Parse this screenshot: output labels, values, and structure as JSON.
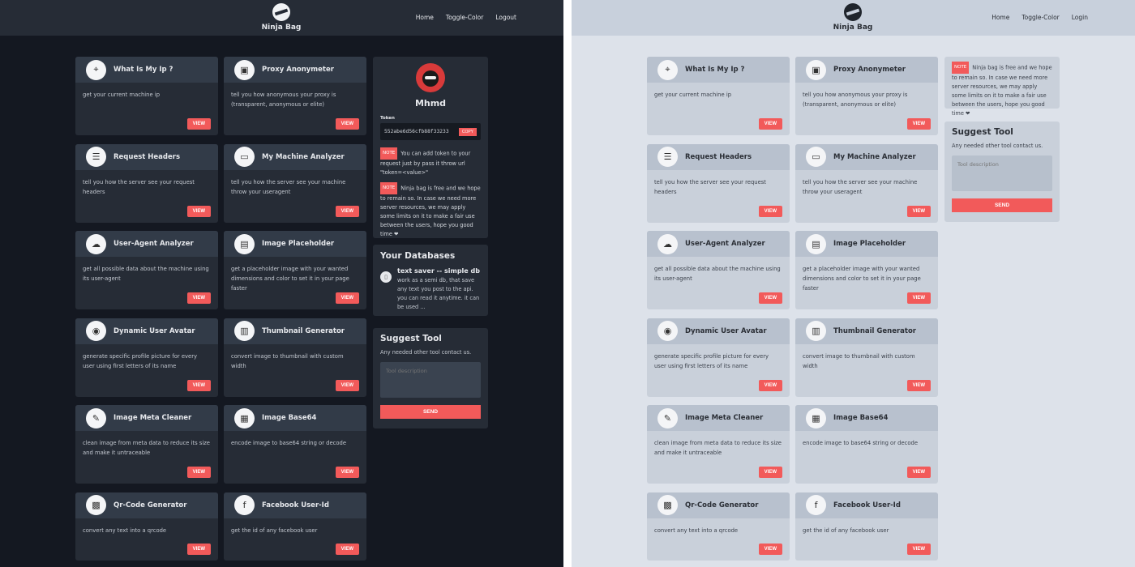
{
  "brand": "Ninja Bag",
  "nav_dark": [
    "Home",
    "Toggle-Color",
    "Logout"
  ],
  "nav_light": [
    "Home",
    "Toggle-Color",
    "Login"
  ],
  "tools": [
    {
      "title": "What Is My Ip ?",
      "desc": "get your current machine ip",
      "icon": "ip-icon",
      "glyph": "⌖"
    },
    {
      "title": "Proxy Anonymeter",
      "desc": "tell you how anonymous your proxy is (transparent, anonymous or elite)",
      "icon": "proxy-icon",
      "glyph": "▣"
    },
    {
      "title": "Request Headers",
      "desc": "tell you how the server see your request headers",
      "icon": "headers-icon",
      "glyph": "☰"
    },
    {
      "title": "My Machine Analyzer",
      "desc": "tell you how the server see your machine throw your useragent",
      "icon": "machine-icon",
      "glyph": "▭"
    },
    {
      "title": "User-Agent Analyzer",
      "desc": "get all possible data about the machine using its user-agent",
      "icon": "user-agent-icon",
      "glyph": "☁"
    },
    {
      "title": "Image Placeholder",
      "desc": "get a placeholder image with your wanted dimensions and color to set it in your page faster",
      "icon": "placeholder-icon",
      "glyph": "▤"
    },
    {
      "title": "Dynamic User Avatar",
      "desc": "generate specific profile picture for every user using first letters of its name",
      "icon": "avatar-icon",
      "glyph": "◉"
    },
    {
      "title": "Thumbnail Generator",
      "desc": "convert image to thumbnail with custom width",
      "icon": "thumbnail-icon",
      "glyph": "▥"
    },
    {
      "title": "Image Meta Cleaner",
      "desc": "clean image from meta data to reduce its size and make it untraceable",
      "icon": "meta-cleaner-icon",
      "glyph": "✎"
    },
    {
      "title": "Image Base64",
      "desc": "encode image to base64 string or decode",
      "icon": "base64-icon",
      "glyph": "▦"
    },
    {
      "title": "Qr-Code Generator",
      "desc": "convert any text into a qrcode",
      "icon": "qrcode-icon",
      "glyph": "▩"
    },
    {
      "title": "Facebook User-Id",
      "desc": "get the id of any facebook user",
      "icon": "facebook-icon",
      "glyph": "f"
    }
  ],
  "view_label": "VIEW",
  "profile": {
    "name": "Mhmd",
    "token_label": "Token",
    "token": "552abe6d56cfb88f33233",
    "copy_label": "COPY",
    "note_tag": "NOTE",
    "note1": "You can add token to your request just by pass it throw url \"token=<value>\"",
    "note2": "Ninja bag is free and we hope to remain so. In case we need more server resources, we may apply some limits on it to make a fair use between the users, hope you good time ❤"
  },
  "databases": {
    "title": "Your Databases",
    "item_title": "text saver -- simple db",
    "item_desc": "work as a semi db, that save any text you post to the api. you can read it anytime. it can be used ..."
  },
  "suggest": {
    "title": "Suggest Tool",
    "subtitle": "Any needed other tool contact us.",
    "placeholder": "Tool description",
    "send_label": "SEND"
  },
  "colors": {
    "accent": "#f25a5a",
    "dark_bg": "#141821",
    "light_bg": "#dde2ea"
  }
}
